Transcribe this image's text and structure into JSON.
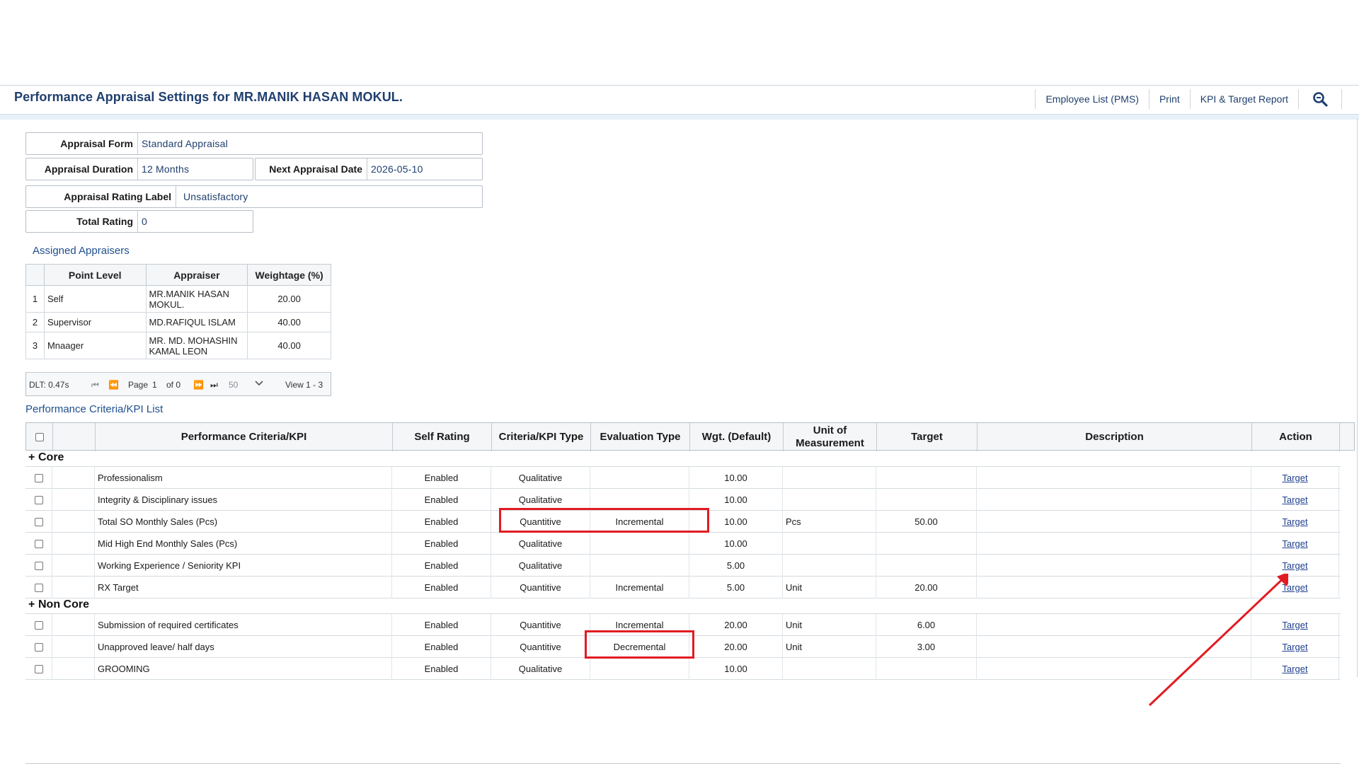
{
  "header": {
    "title": "Performance Appraisal Settings for MR.MANIK HASAN MOKUL.",
    "nav": [
      "Employee List (PMS)",
      "Print",
      "KPI & Target Report"
    ],
    "search_icon": "search-icon"
  },
  "form": {
    "appraisal_form_label": "Appraisal Form",
    "appraisal_form_value": "Standard Appraisal",
    "duration_label": "Appraisal Duration",
    "duration_value": "12 Months",
    "next_date_label": "Next Appraisal Date",
    "next_date_value": "2026-05-10",
    "rating_label_label": "Appraisal Rating Label",
    "rating_label_value": "Unsatisfactory",
    "total_rating_label": "Total Rating",
    "total_rating_value": "0"
  },
  "appraisers": {
    "title": "Assigned Appraisers",
    "columns": [
      "Point Level",
      "Appraiser",
      "Weightage (%)"
    ],
    "rows": [
      {
        "num": "1",
        "level": "Self",
        "appraiser": "MR.MANIK HASAN MOKUL.",
        "weight": "20.00"
      },
      {
        "num": "2",
        "level": "Supervisor",
        "appraiser": "MD.RAFIQUL ISLAM",
        "weight": "40.00"
      },
      {
        "num": "3",
        "level": "Mnaager",
        "appraiser": "MR. MD. MOHASHIN KAMAL LEON",
        "weight": "40.00"
      }
    ],
    "pager": {
      "dlt": "DLT: 0.47s",
      "page_label": "Page",
      "page": "1",
      "of": "of 0",
      "rows": "50",
      "view": "View 1 - 3"
    }
  },
  "kpi": {
    "title": "Performance Criteria/KPI List",
    "columns": [
      "Performance Criteria/KPI",
      "Self Rating",
      "Criteria/KPI Type",
      "Evaluation Type",
      "Wgt. (Default)",
      "Unit of Measurement",
      "Target",
      "Description",
      "Action"
    ],
    "groups": [
      {
        "name": "Core",
        "rows": [
          {
            "name": "Professionalism",
            "self": "Enabled",
            "type": "Qualitative",
            "eval": "",
            "wgt": "10.00",
            "unit": "",
            "target": "",
            "action": "Target"
          },
          {
            "name": "Integrity & Disciplinary issues",
            "self": "Enabled",
            "type": "Qualitative",
            "eval": "",
            "wgt": "10.00",
            "unit": "",
            "target": "",
            "action": "Target"
          },
          {
            "name": "Total SO Monthly Sales (Pcs)",
            "self": "Enabled",
            "type": "Quantitive",
            "eval": "Incremental",
            "wgt": "10.00",
            "unit": "Pcs",
            "target": "50.00",
            "action": "Target"
          },
          {
            "name": "Mid High End Monthly Sales (Pcs)",
            "self": "Enabled",
            "type": "Qualitative",
            "eval": "",
            "wgt": "10.00",
            "unit": "",
            "target": "",
            "action": "Target"
          },
          {
            "name": "Working Experience / Seniority KPI",
            "self": "Enabled",
            "type": "Qualitative",
            "eval": "",
            "wgt": "5.00",
            "unit": "",
            "target": "",
            "action": "Target"
          },
          {
            "name": "RX Target",
            "self": "Enabled",
            "type": "Quantitive",
            "eval": "Incremental",
            "wgt": "5.00",
            "unit": "Unit",
            "target": "20.00",
            "action": "Target"
          }
        ]
      },
      {
        "name": "Non Core",
        "rows": [
          {
            "name": "Submission of required certificates",
            "self": "Enabled",
            "type": "Quantitive",
            "eval": "Incremental",
            "wgt": "20.00",
            "unit": "Unit",
            "target": "6.00",
            "action": "Target"
          },
          {
            "name": "Unapproved leave/ half days",
            "self": "Enabled",
            "type": "Quantitive",
            "eval": "Decremental",
            "wgt": "20.00",
            "unit": "Unit",
            "target": "3.00",
            "action": "Target"
          },
          {
            "name": "GROOMING",
            "self": "Enabled",
            "type": "Qualitative",
            "eval": "",
            "wgt": "10.00",
            "unit": "",
            "target": "",
            "action": "Target"
          }
        ]
      }
    ]
  },
  "colors": {
    "accent": "#1f3f6e",
    "highlight": "#e21b23"
  }
}
